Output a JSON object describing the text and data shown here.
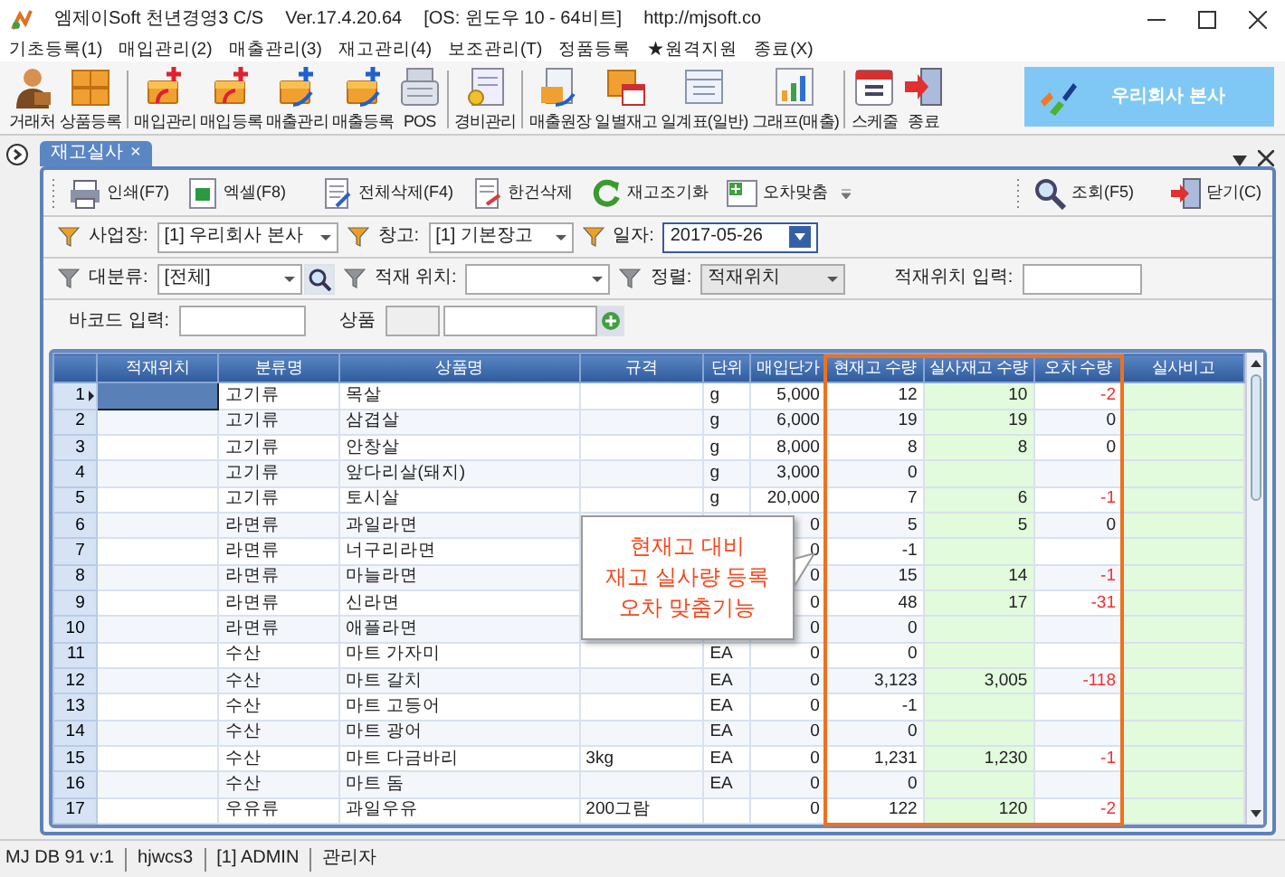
{
  "window": {
    "title": "엠제이Soft 천년경영3 C/S",
    "version": "Ver.17.4.20.64",
    "os": "[OS: 윈도우 10 - 64비트]",
    "url": "http://mjsoft.co"
  },
  "menu": [
    "기초등록(1)",
    "매입관리(2)",
    "매출관리(3)",
    "재고관리(4)",
    "보조관리(T)",
    "정품등록",
    "★원격지원",
    "종료(X)"
  ],
  "toolbar": [
    [
      "거래처",
      "상품등록"
    ],
    [
      "매입관리",
      "매입등록",
      "매출관리",
      "매출등록",
      "POS"
    ],
    [
      "경비관리"
    ],
    [
      "매출원장",
      "일별재고",
      "일계표(일반)",
      "그래프(매출)"
    ],
    [
      "스케줄",
      "종료"
    ]
  ],
  "company": "우리회사 본사",
  "tabs": [
    {
      "label": "재고실사",
      "selected": true,
      "close": "×"
    }
  ],
  "doc_toolbar": {
    "left": [
      [
        "인쇄(F7)",
        "엑셀(F8)"
      ],
      [
        "전체삭제(F4)",
        "한건삭제",
        "재고조기화",
        "오차맞춤"
      ]
    ],
    "right": [
      [
        "조회(F5)"
      ],
      [
        "닫기(C)"
      ]
    ]
  },
  "filters": [
    [
      {
        "kind": "select",
        "funnel": true,
        "required": true,
        "label": "사업장:",
        "value": "[1] 우리회사 본사"
      },
      {
        "kind": "select",
        "funnel": true,
        "required": true,
        "label": "창고:",
        "value": "[1] 기본장고"
      },
      {
        "kind": "date",
        "funnel": true,
        "required": true,
        "label": "일자:",
        "value": "2017-05-26"
      }
    ],
    [
      {
        "kind": "search-select",
        "funnel": true,
        "required": false,
        "label": "대분류:",
        "value": "[전체]"
      },
      {
        "kind": "select",
        "funnel": true,
        "required": false,
        "label": "적재 위치:"
      },
      {
        "kind": "readonly-select",
        "funnel": true,
        "required": false,
        "label": "정렬:",
        "value": "적재위치"
      },
      {
        "kind": "text",
        "label": "적재위치 입력:"
      }
    ],
    [
      {
        "kind": "text",
        "label": "바코드 입력:"
      },
      {
        "kind": "product",
        "label": "상품"
      }
    ]
  ],
  "table": {
    "columns": [
      {
        "label": "적재위치",
        "kind": "text",
        "editable": false,
        "highlighted": false
      },
      {
        "label": "분류명",
        "kind": "text",
        "editable": false,
        "highlighted": false
      },
      {
        "label": "상품명",
        "kind": "text",
        "editable": false,
        "highlighted": false
      },
      {
        "label": "규격",
        "kind": "text",
        "editable": false,
        "highlighted": false
      },
      {
        "label": "단위",
        "kind": "text",
        "editable": false,
        "highlighted": false
      },
      {
        "label": "매입단가",
        "kind": "number",
        "editable": false,
        "highlighted": false
      },
      {
        "label": "현재고 수량",
        "kind": "number",
        "editable": false,
        "highlighted": true
      },
      {
        "label": "실사재고 수량",
        "kind": "number",
        "editable": true,
        "highlighted": true
      },
      {
        "label": "오차 수량",
        "kind": "diff",
        "editable": false,
        "highlighted": true
      },
      {
        "label": "실사비고",
        "kind": "text",
        "editable": true,
        "highlighted": false
      }
    ],
    "rows": [
      {
        "no": "1",
        "selected": true,
        "cells": [
          null,
          "고기류",
          "목살",
          null,
          "g",
          "5,000",
          "12",
          "10",
          "-2",
          null
        ]
      },
      {
        "no": "2",
        "selected": false,
        "cells": [
          null,
          "고기류",
          "삼겹살",
          null,
          "g",
          "6,000",
          "19",
          "19",
          "0",
          null
        ]
      },
      {
        "no": "3",
        "selected": false,
        "cells": [
          null,
          "고기류",
          "안창살",
          null,
          "g",
          "8,000",
          "8",
          "8",
          "0",
          null
        ]
      },
      {
        "no": "4",
        "selected": false,
        "cells": [
          null,
          "고기류",
          "앞다리살(돼지)",
          null,
          "g",
          "3,000",
          "0",
          null,
          null,
          null
        ]
      },
      {
        "no": "5",
        "selected": false,
        "cells": [
          null,
          "고기류",
          "토시살",
          null,
          "g",
          "20,000",
          "7",
          "6",
          "-1",
          null
        ]
      },
      {
        "no": "6",
        "selected": false,
        "cells": [
          null,
          "라면류",
          "과일라면",
          null,
          null,
          "0",
          "5",
          "5",
          "0",
          null
        ]
      },
      {
        "no": "7",
        "selected": false,
        "cells": [
          null,
          "라면류",
          "너구리라면",
          null,
          null,
          "0",
          "-1",
          null,
          null,
          null
        ]
      },
      {
        "no": "8",
        "selected": false,
        "cells": [
          null,
          "라면류",
          "마늘라면",
          null,
          null,
          "0",
          "15",
          "14",
          "-1",
          null
        ]
      },
      {
        "no": "9",
        "selected": false,
        "cells": [
          null,
          "라면류",
          "신라면",
          null,
          null,
          "0",
          "48",
          "17",
          "-31",
          null
        ]
      },
      {
        "no": "10",
        "selected": false,
        "cells": [
          null,
          "라면류",
          "애플라면",
          null,
          null,
          "0",
          "0",
          null,
          null,
          null
        ]
      },
      {
        "no": "11",
        "selected": false,
        "cells": [
          null,
          "수산",
          "마트 가자미",
          null,
          "EA",
          "0",
          "0",
          null,
          null,
          null
        ]
      },
      {
        "no": "12",
        "selected": false,
        "cells": [
          null,
          "수산",
          "마트 갈치",
          null,
          "EA",
          "0",
          "3,123",
          "3,005",
          "-118",
          null
        ]
      },
      {
        "no": "13",
        "selected": false,
        "cells": [
          null,
          "수산",
          "마트 고등어",
          null,
          "EA",
          "0",
          "-1",
          null,
          null,
          null
        ]
      },
      {
        "no": "14",
        "selected": false,
        "cells": [
          null,
          "수산",
          "마트 광어",
          null,
          "EA",
          "0",
          "0",
          null,
          null,
          null
        ]
      },
      {
        "no": "15",
        "selected": false,
        "cells": [
          null,
          "수산",
          "마트 다금바리",
          "3kg",
          "EA",
          "0",
          "1,231",
          "1,230",
          "-1",
          null
        ]
      },
      {
        "no": "16",
        "selected": false,
        "cells": [
          null,
          "수산",
          "마트 돔",
          null,
          "EA",
          "0",
          "0",
          null,
          null,
          null
        ]
      },
      {
        "no": "17",
        "selected": false,
        "cells": [
          null,
          "우유류",
          "과일우유",
          "200그람",
          null,
          "0",
          "122",
          "120",
          "-2",
          null
        ]
      }
    ]
  },
  "callout": {
    "lines": [
      "현재고 대비",
      "재고 실사량 등록",
      "오차 맞춤기능"
    ]
  },
  "status_bar": [
    "MJ DB 91 v:1",
    "hjwcs3",
    "[1] ADMIN",
    "관리자"
  ]
}
